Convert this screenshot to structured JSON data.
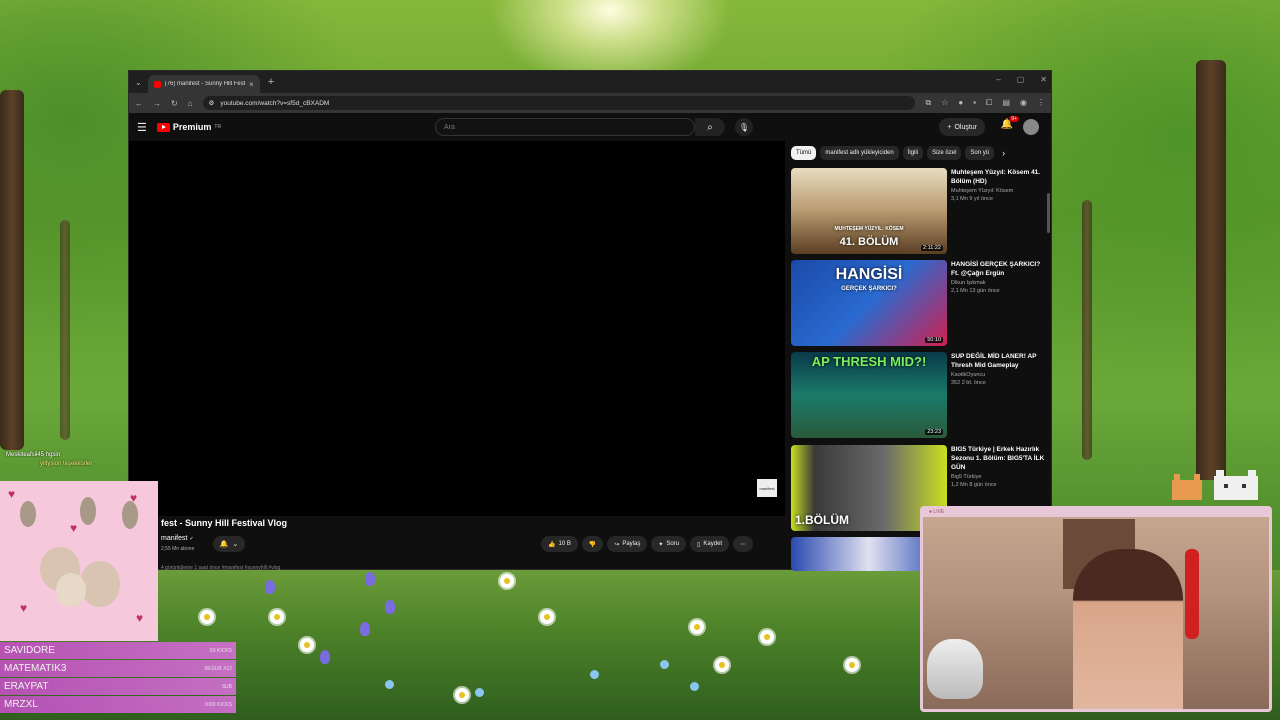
{
  "browser": {
    "tab_title": "(76) manifest - Sunny Hill Festi...",
    "url": "youtube.com/watch?v=sf5d_cBXADM"
  },
  "youtube": {
    "logo_text": "Premium",
    "logo_sup": "TR",
    "search_placeholder": "Ara",
    "create_label": "Oluştur",
    "notif_count": "9+",
    "video": {
      "title": "fest - Sunny Hill Festival Vlog",
      "channel": "manifest",
      "subs": "2,55 Mn abone",
      "likes": "10 B",
      "share": "Paylaş",
      "ask": "Soru",
      "save": "Kaydet",
      "description": "4 görüntüleme  1 saat önce  #manifest #sunnyhill #vlog",
      "watermark": "manifest"
    },
    "chips": [
      "Tümü",
      "manifest adlı yükleyiciden",
      "İlgili",
      "Size özel",
      "Son yü"
    ],
    "recs": [
      {
        "title": "Muhteşem Yüzyıl: Kösem 41. Bölüm (HD)",
        "channel": "Muhteşem Yüzyıl: Kösem",
        "meta": "3,1 Mn  9 yıl önce",
        "duration": "2:11:22",
        "caption": "41. BÖLÜM",
        "sub_caption": "MUHTEŞEM YÜZYIL: KÖSEM"
      },
      {
        "title": "HANGİSİ GERÇEK ŞARKICI? Ft. @Çağrı Ergün",
        "channel": "Dikun Işıkmak",
        "meta": "2,1 Mn  13 gün önce",
        "duration": "50:10",
        "caption": "HANGİSİ",
        "sub_caption": "GERÇEK ŞARKICI?"
      },
      {
        "title": "SUP DEĞİL MİD LANER! AP Thresh Mid Gameplay",
        "channel": "KaotikOyuncu",
        "meta": "352  2 bt. önce",
        "duration": "23:23",
        "caption": "AP THRESH MID?!",
        "sub_caption": ""
      },
      {
        "title": "BIG5 Türkiye | Erkek Hazırlık Sezonu 1. Bölüm: BIG5'TA İLK GÜN",
        "channel": "Big5 Türkiye",
        "meta": "1,2 Mn  8 gün önce",
        "duration": "",
        "caption": "1.BÖLÜM",
        "sub_caption": ""
      }
    ]
  },
  "overlay": {
    "chat_line1": "Meskiteafsii45 hgsin",
    "chat_line2": "yiltysion teşekkürler",
    "gifters": [
      {
        "name": "SAVIDORE",
        "value": "50 KICKS"
      },
      {
        "name": "MATEMATIK3",
        "value": "RESUB X12"
      },
      {
        "name": "ERAYPAT",
        "value": "SUB"
      },
      {
        "name": "MRZXL",
        "value": "1000 KICKS"
      }
    ],
    "cam_label": "● LIVE"
  }
}
